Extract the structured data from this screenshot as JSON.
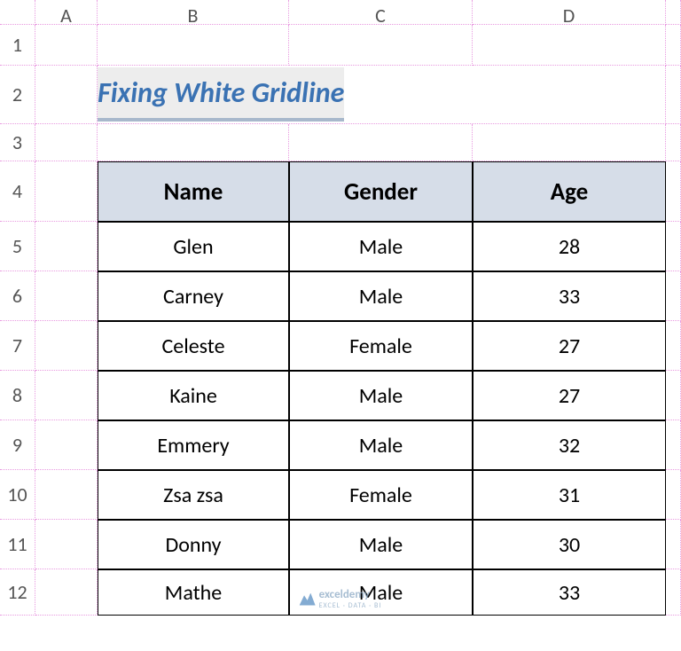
{
  "columns": [
    "A",
    "B",
    "C",
    "D"
  ],
  "rows": [
    "1",
    "2",
    "3",
    "4",
    "5",
    "6",
    "7",
    "8",
    "9",
    "10",
    "11",
    "12"
  ],
  "title": "Fixing White Gridline",
  "chart_data": {
    "type": "table",
    "headers": [
      "Name",
      "Gender",
      "Age"
    ],
    "rows": [
      {
        "name": "Glen",
        "gender": "Male",
        "age": 28
      },
      {
        "name": "Carney",
        "gender": "Male",
        "age": 33
      },
      {
        "name": "Celeste",
        "gender": "Female",
        "age": 27
      },
      {
        "name": "Kaine",
        "gender": "Male",
        "age": 27
      },
      {
        "name": "Emmery",
        "gender": "Male",
        "age": 32
      },
      {
        "name": "Zsa zsa",
        "gender": "Female",
        "age": 31
      },
      {
        "name": "Donny",
        "gender": "Male",
        "age": 30
      },
      {
        "name": "Mathe",
        "gender": "Male",
        "age": 33
      }
    ]
  },
  "watermark": {
    "brand": "exceldemy",
    "tagline": "EXCEL · DATA · BI"
  }
}
